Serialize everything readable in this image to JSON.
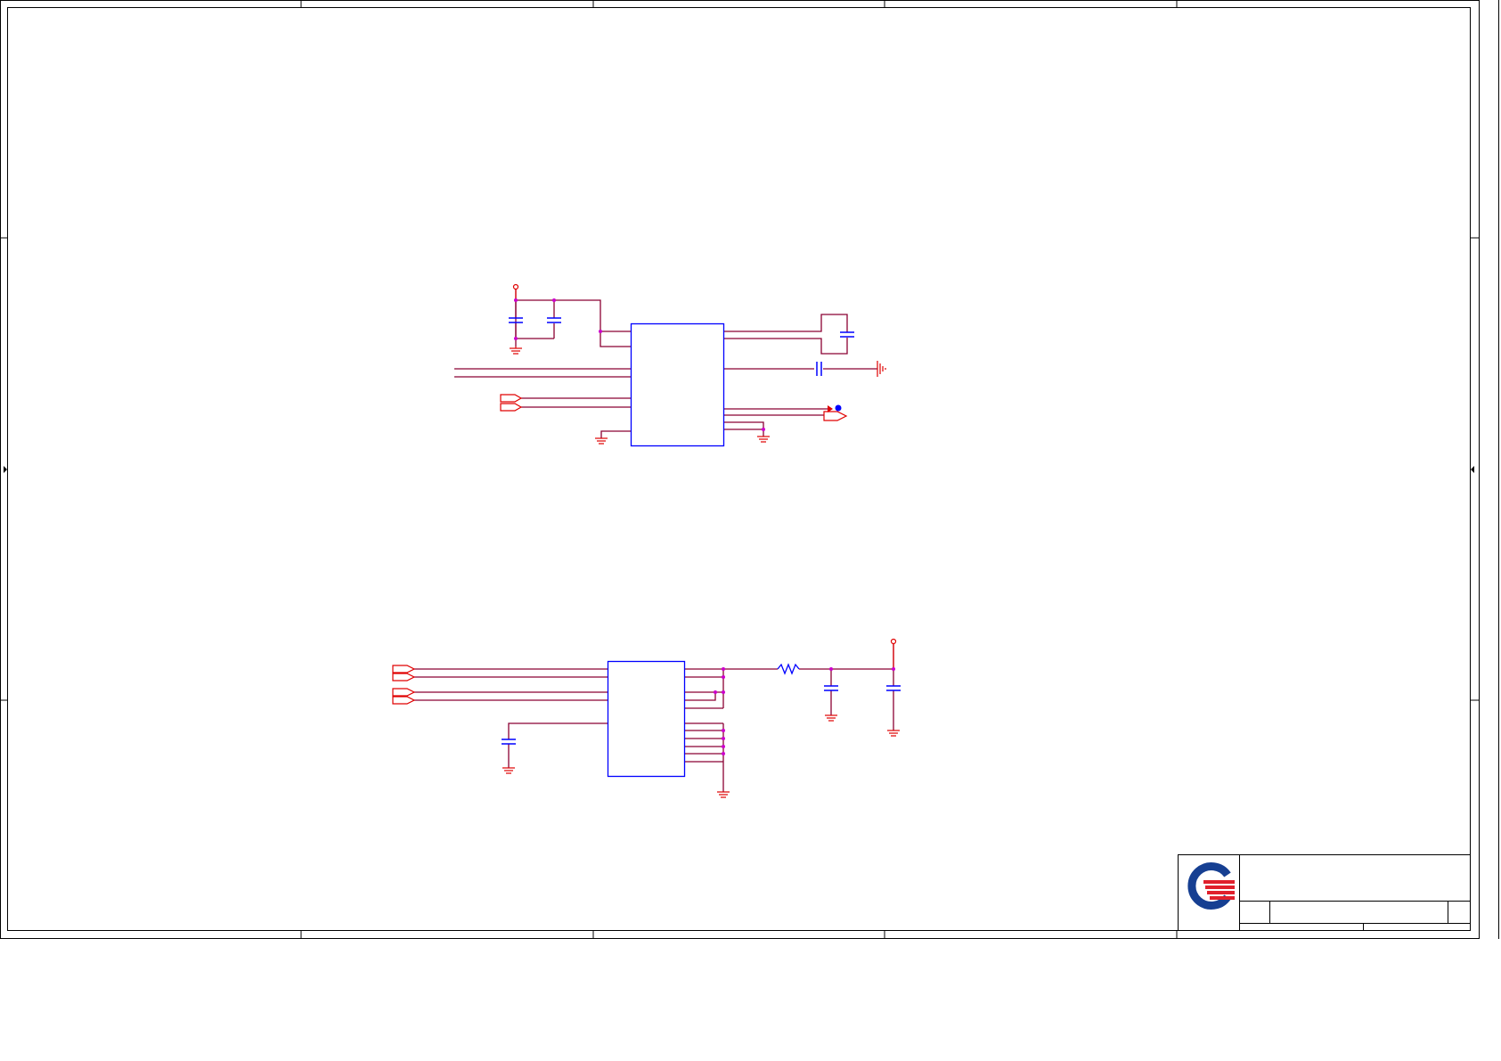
{
  "colors": {
    "background": "#ffffff",
    "frame": "#000000",
    "wire": "#8b0033",
    "net_port": "#e00000",
    "component": "#0000ff",
    "junction": "#cc00cc",
    "ground": "#e00000",
    "logo_blue": "#163f92",
    "logo_red": "#e0202c"
  },
  "schematic": {
    "text": []
  },
  "title_block": {
    "logo": "company-logo"
  }
}
